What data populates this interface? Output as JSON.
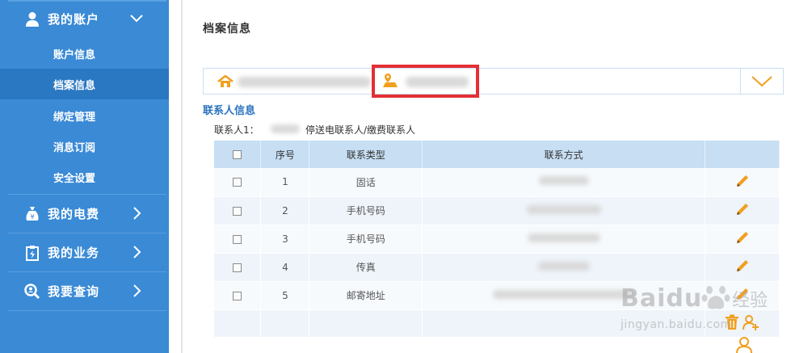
{
  "sidebar": {
    "groups": [
      {
        "label": "我的账户",
        "icon": "user-icon",
        "expanded": true
      },
      {
        "label": "我的电费",
        "icon": "money-bag-icon",
        "expanded": false
      },
      {
        "label": "我的业务",
        "icon": "clipboard-icon",
        "expanded": false
      },
      {
        "label": "我要查询",
        "icon": "search-icon",
        "expanded": false
      }
    ],
    "subitems": [
      {
        "label": "账户信息",
        "active": false
      },
      {
        "label": "档案信息",
        "active": true
      },
      {
        "label": "绑定管理",
        "active": false
      },
      {
        "label": "消息订阅",
        "active": false
      },
      {
        "label": "安全设置",
        "active": false
      }
    ]
  },
  "main": {
    "page_title": "档案信息",
    "section_title": "联系人信息",
    "contact_label": "联系人1：",
    "contact_type": "停送电联系人/缴费联系人",
    "table": {
      "headers": [
        "",
        "序号",
        "联系类型",
        "联系方式",
        ""
      ],
      "rows": [
        {
          "no": "1",
          "type": "固话"
        },
        {
          "no": "2",
          "type": "手机号码"
        },
        {
          "no": "3",
          "type": "手机号码"
        },
        {
          "no": "4",
          "type": "传真"
        },
        {
          "no": "5",
          "type": "邮寄地址"
        }
      ]
    }
  },
  "watermark": {
    "brand": "Baidu",
    "suffix": "经验",
    "url": "jingyan.baidu.com"
  },
  "colors": {
    "sidebar_bg": "#3a8ad6",
    "sidebar_active": "#2b78c2",
    "table_header": "#c7def3",
    "accent_orange": "#f0a020",
    "highlight_red": "#e42f34",
    "link_blue": "#2a73be"
  }
}
